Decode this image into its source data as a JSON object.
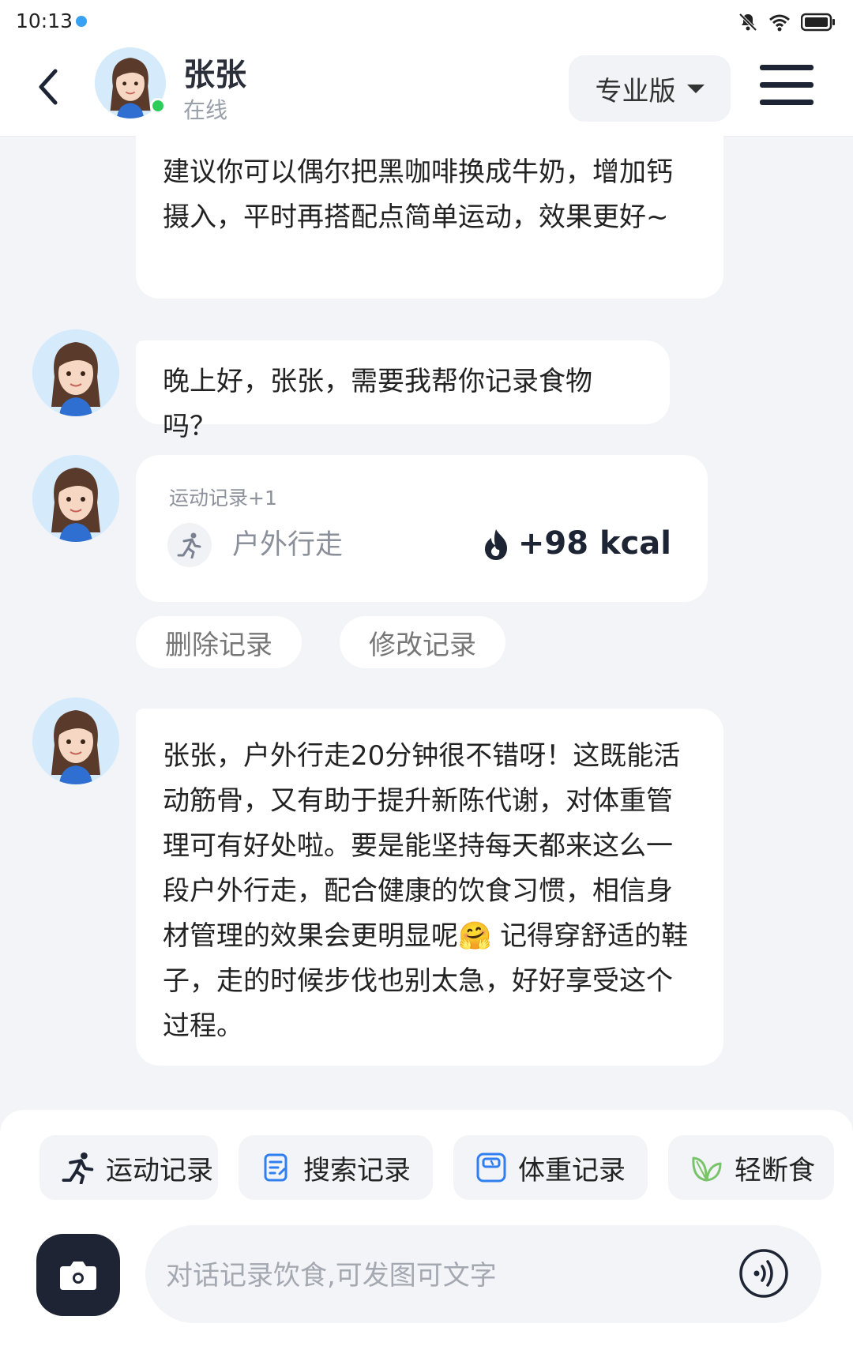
{
  "status_bar": {
    "time": "10:13"
  },
  "header": {
    "contact_name": "张张",
    "contact_status": "在线",
    "version_label": "专业版"
  },
  "messages": {
    "m1_text": "建议你可以偶尔把黑咖啡换成牛奶，增加钙摄入，平时再搭配点简单运动，效果更好~",
    "m2_text": "晚上好，张张，需要我帮你记录食物吗？",
    "m4_text": "张张，户外行走20分钟很不错呀！这既能活动筋骨，又有助于提升新陈代谢，对体重管理可有好处啦。要是能坚持每天都来这么一段户外行走，配合健康的饮食习惯，相信身材管理的效果会更明显呢🤗 记得穿舒适的鞋子，走的时候步伐也别太急，好好享受这个过程。"
  },
  "exercise_card": {
    "title": "运动记录+1",
    "activity": "户外行走",
    "kcal": "+98 kcal",
    "delete_label": "删除记录",
    "edit_label": "修改记录"
  },
  "quick_actions": [
    {
      "label": "运动记录",
      "icon": "running-icon"
    },
    {
      "label": "搜索记录",
      "icon": "note-search-icon"
    },
    {
      "label": "体重记录",
      "icon": "scale-icon"
    },
    {
      "label": "轻断食",
      "icon": "leaf-icon"
    }
  ],
  "input": {
    "placeholder": "对话记录饮食,可发图可文字"
  },
  "colors": {
    "accent_blue": "#2f7ff0",
    "online_green": "#2ecc5a",
    "leaf_green": "#79c46a",
    "dark": "#1e2433",
    "background": "#f3f4f8"
  }
}
